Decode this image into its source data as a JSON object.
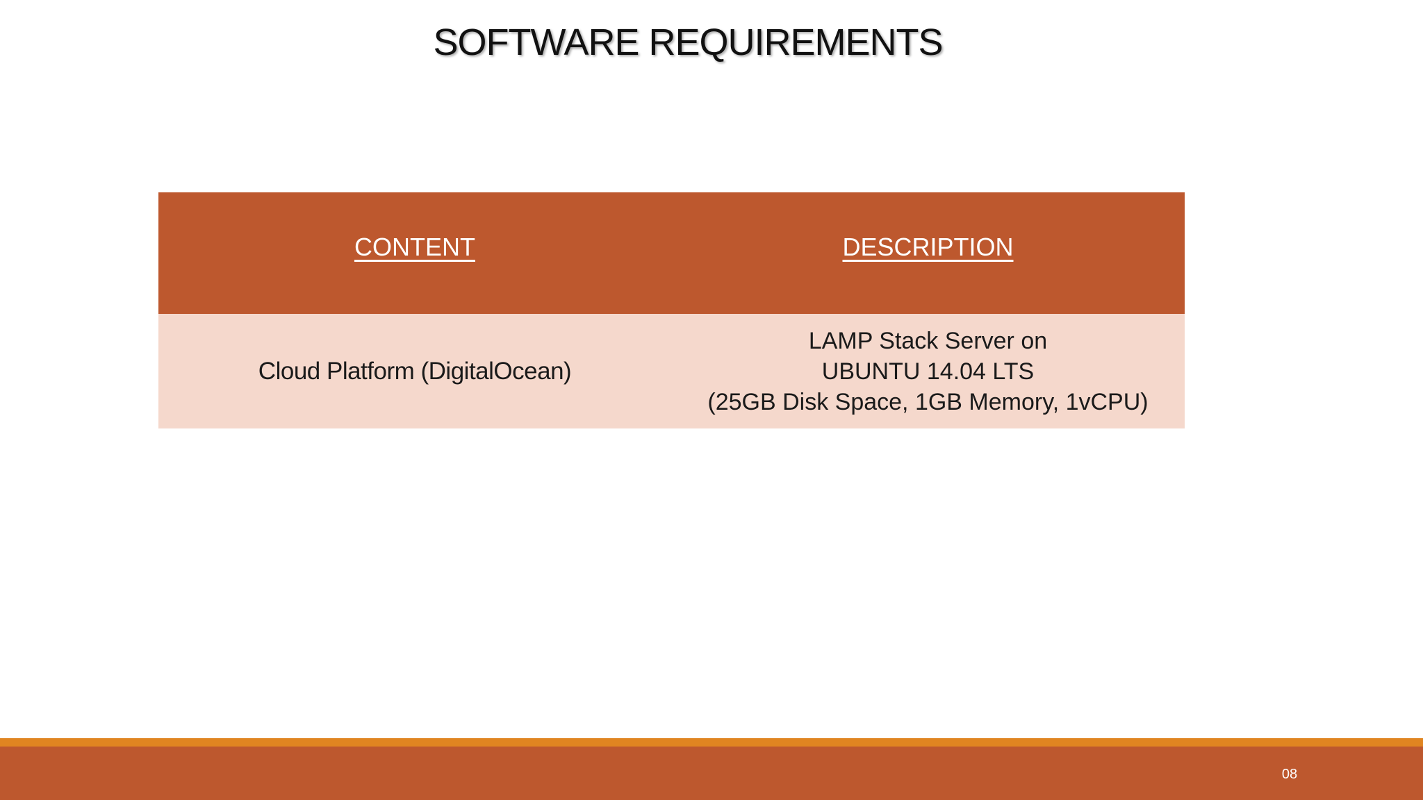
{
  "slide": {
    "title": "SOFTWARE REQUIREMENTS",
    "page_number": "08"
  },
  "table": {
    "headers": [
      "CONTENT",
      "DESCRIPTION"
    ],
    "rows": [
      {
        "content": "Cloud Platform (DigitalOcean)",
        "description_lines": [
          "LAMP Stack Server on",
          "UBUNTU 14.04 LTS",
          "(25GB Disk Space, 1GB Memory, 1vCPU)"
        ]
      }
    ]
  },
  "colors": {
    "header_fill": "#bd582e",
    "row_fill": "#f5d8cc",
    "footer_bar": "#bd582e",
    "footer_accent": "#e08521"
  }
}
